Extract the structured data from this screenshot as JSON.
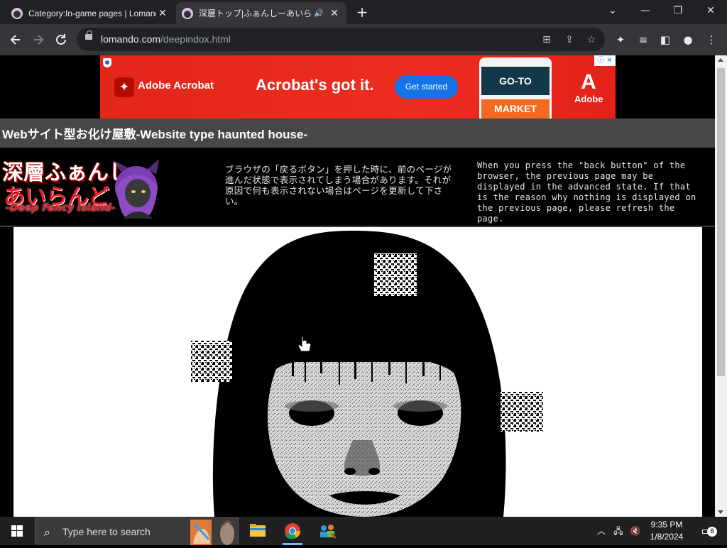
{
  "browser": {
    "tabs": [
      {
        "title": "Category:In-game pages | Lomando",
        "active": false
      },
      {
        "title": "深層トップ|ふぁんしーあいらんど",
        "active": true
      }
    ],
    "url_domain": "lomando.com",
    "url_path": "/deepindox.html",
    "icons": {
      "back": "back-arrow-icon",
      "forward": "forward-arrow-icon",
      "reload": "reload-icon",
      "translate": "translate-icon",
      "share": "share-icon",
      "bookmark": "star-icon",
      "extensions": "puzzle-icon",
      "media": "media-queue-icon",
      "sidepanel": "side-panel-icon",
      "profile": "profile-icon",
      "menu": "kebab-menu-icon"
    }
  },
  "ad": {
    "brand": "Adobe Acrobat",
    "headline": "Acrobat's got it.",
    "cta": "Get started",
    "phone_top": "GO-TO",
    "phone_bottom": "MARKET",
    "logo_word": "Adobe",
    "adchoices": "ⓘ ✕"
  },
  "site": {
    "header": "Webサイト型お化け屋敷-Website type haunted house-",
    "logo_line1": "深層ふぁんしー",
    "logo_line2": "あいらんど",
    "logo_line3": "-Deep Fancy Island-",
    "notice_jp": "ブラウザの「戻るボタン」を押した時に、前のページが進んだ状態で表示されてしまう場合があります。それが原因で何も表示されない場合はページを更新して下さい。",
    "notice_en": "When you press the \"back button\" of the browser, the previous page may be displayed in the advanced state. If that is the reason why nothing is displayed on the previous page, please refresh the page."
  },
  "taskbar": {
    "search_placeholder": "Type here to search",
    "time": "9:35 PM",
    "date": "1/8/2024",
    "notification_count": "8"
  },
  "colors": {
    "ad_red": "#ee2d21",
    "cta_blue": "#1473e6",
    "site_bar": "#474747",
    "logo_red": "#f01c26"
  }
}
